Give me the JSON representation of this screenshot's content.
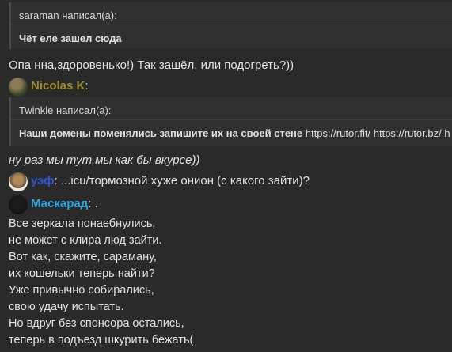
{
  "quote1": {
    "header": "saraman написал(а):",
    "body": "Чёт еле зашел сюда"
  },
  "reply1": "Опа нна,здоровенько!) Так зашёл, или подогреть?))",
  "post_nicolas": {
    "author": "Nicolas K",
    "author_color": "#9c8c2a",
    "suffix": ":"
  },
  "quote2": {
    "header": "Twinkle написал(а):",
    "body_bold": "Наши домены поменялись запишите их на своей стене",
    "body_rest": " https://rutor.fit/ https://rutor.bz/ h"
  },
  "italic_line": "ну раз мы тут,мы как бы вкурсе))",
  "post_uef": {
    "author": "уэф",
    "author_color": "#2f55d4",
    "text": ": ...icu/тормозной хуже онион (с какого зайти)?"
  },
  "post_mask": {
    "author": "Маскарад",
    "author_color": "#2aa6e0",
    "text": ": ."
  },
  "poem": [
    "Все зеркала понаебнулись,",
    "не может с клира люд зайти.",
    "Вот как, скажите, сараману,",
    "их кошельки теперь найти?",
    "Уже привычно собирались,",
    "свою удачу испытать.",
    "Но вдруг без спонсора остались,",
    "теперь в подъезд шкурить бежать("
  ]
}
